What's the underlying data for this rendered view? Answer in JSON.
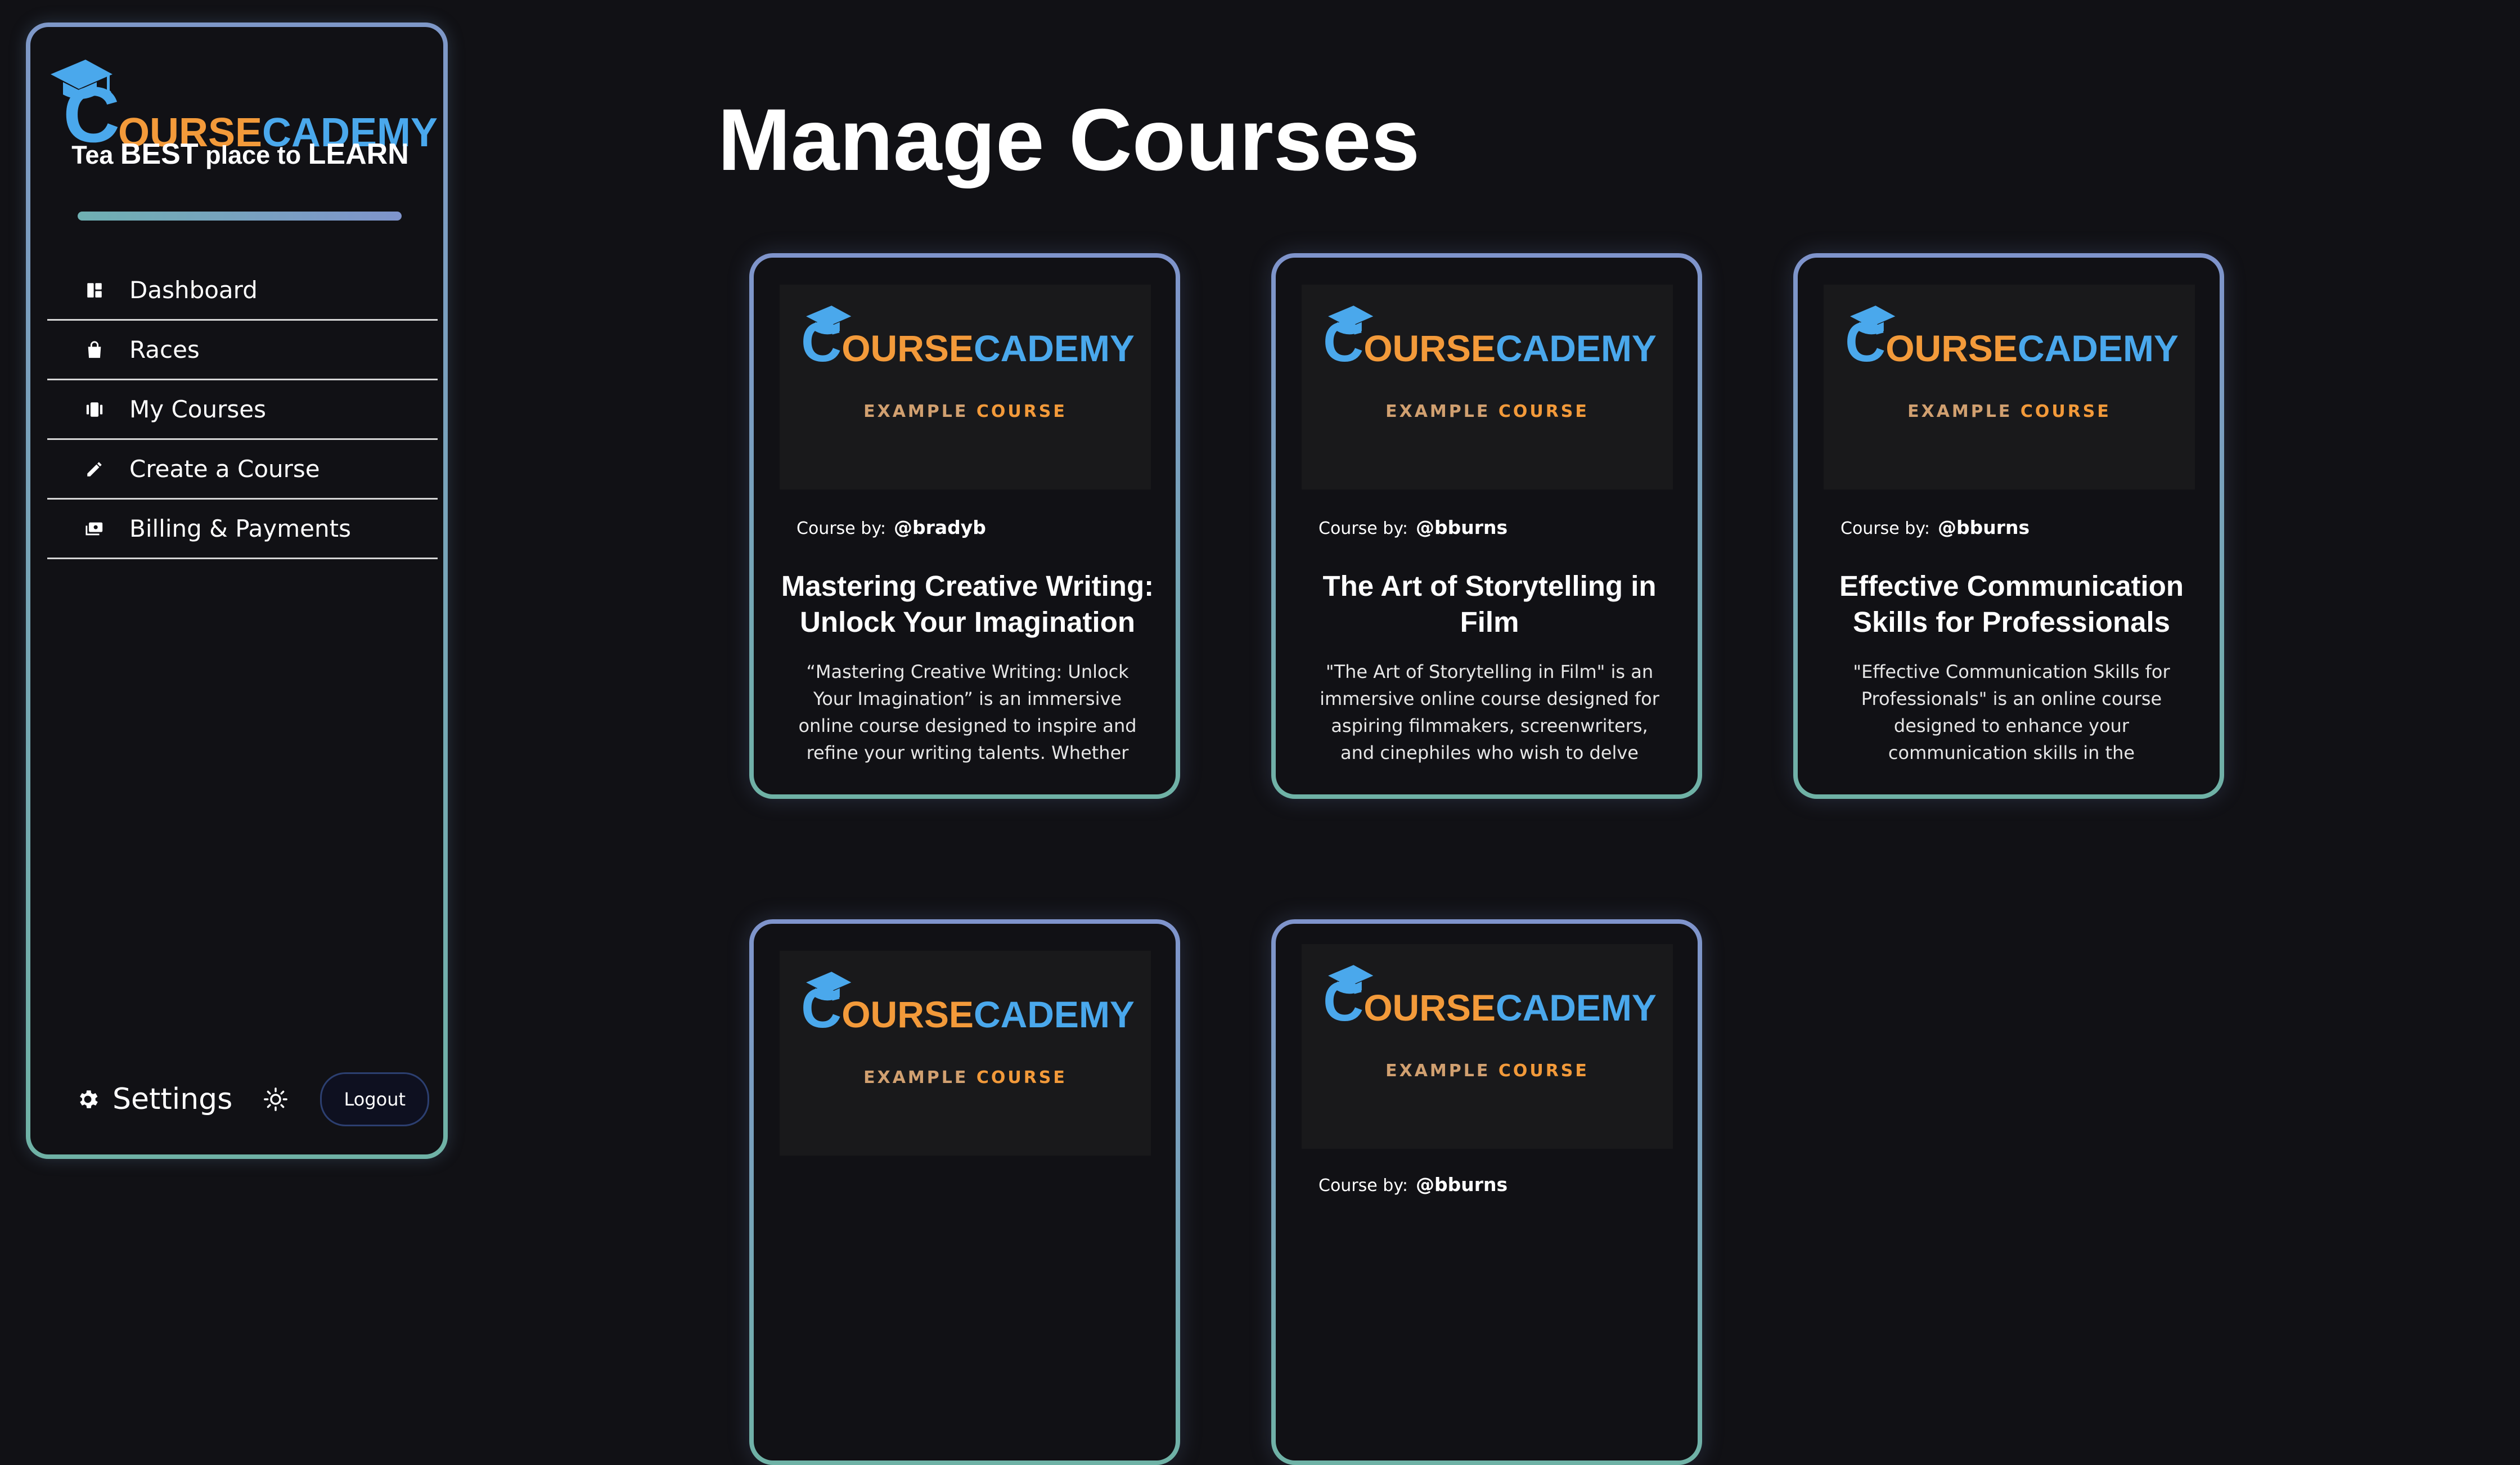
{
  "sidebar": {
    "brand": {
      "c": "C",
      "part1": "OURSE",
      "part2": "CADEMY"
    },
    "tagline": {
      "p1": "Tea ",
      "p2": "BEST",
      "p3": " place to ",
      "p4": "LEARN"
    },
    "nav": [
      {
        "label": "Dashboard",
        "icon": "dashboard-icon"
      },
      {
        "label": "Races",
        "icon": "shopping-bag-icon"
      },
      {
        "label": "My Courses",
        "icon": "courses-icon"
      },
      {
        "label": "Create a Course",
        "icon": "pencil-icon"
      },
      {
        "label": "Billing & Payments",
        "icon": "payments-icon"
      }
    ],
    "settings_label": "Settings",
    "logout_label": "Logout"
  },
  "main": {
    "title": "Manage Courses",
    "thumb_subtitle": {
      "a": "EXAMPLE",
      "b": "COURSE"
    },
    "byline_prefix": "Course by:",
    "courses": [
      {
        "author": "@bradyb",
        "title": "Mastering Creative Writing: Unlock Your Imagination",
        "description": "“Mastering Creative Writing: Unlock Your Imagination” is an immersive online course designed to inspire and refine your writing talents. Whether you're a buddin..."
      },
      {
        "author": "@bburns",
        "title": "The Art of Storytelling in Film",
        "description": "\"The Art of Storytelling in Film\" is an immersive online course designed for aspiring filmmakers, screenwriters, and cinephiles who wish to delve deep into the ..."
      },
      {
        "author": "@bburns",
        "title": "Effective Communication Skills for Professionals",
        "description": "\"Effective Communication Skills for Professionals\" is an online course designed to enhance your communication skills in the workplace. Through practical strateg..."
      },
      {
        "author": "",
        "title": "",
        "description": ""
      },
      {
        "author": "@bburns",
        "title": "",
        "description": ""
      }
    ]
  },
  "colors": {
    "brand_blue": "#4aa8ec",
    "brand_orange": "#f39a3a",
    "background": "#111115"
  }
}
